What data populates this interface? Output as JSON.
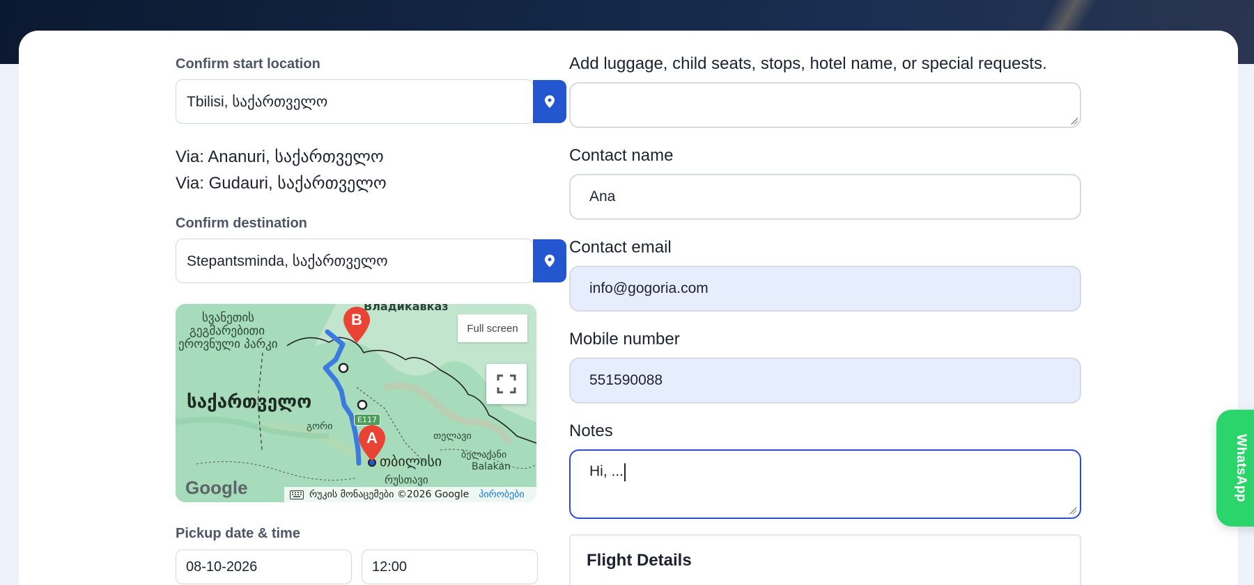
{
  "start": {
    "label": "Confirm start location",
    "value": "Tbilisi, საქართველო"
  },
  "vias": [
    "Via: Ananuri, საქართველო",
    "Via: Gudauri, საქართველო"
  ],
  "destination": {
    "label": "Confirm destination",
    "value": "Stepantsminda, საქართველო"
  },
  "map": {
    "full_screen_label": "Full screen",
    "google": "Google",
    "attribution": "რუკის მონაცემები ©2026 Google",
    "terms": "პირობები",
    "marker_a": "A",
    "marker_b": "B",
    "road_label": "E117",
    "places": {
      "vladikavkaz": "Владикавказ",
      "georgia": "საქართველო",
      "tbilisi": "თბილისი",
      "rustavi": "რუსთავი",
      "gori": "გორი",
      "telavi": "თელავი",
      "belakani": "ბელაქანი",
      "balakan": "Balakan",
      "park1": "სვანეთის",
      "park2": "ეროვნული პარკი",
      "park3": "გეგმარებითი"
    }
  },
  "pickup": {
    "label": "Pickup date & time",
    "date": "08-10-2026",
    "time": "12:00"
  },
  "requests": {
    "label": "Add luggage, child seats, stops, hotel name, or special requests.",
    "value": ""
  },
  "contact_name": {
    "label": "Contact name",
    "value": "Ana"
  },
  "contact_email": {
    "label": "Contact email",
    "value": "info@gogoria.com"
  },
  "mobile": {
    "label": "Mobile number",
    "value": "551590088"
  },
  "notes": {
    "label": "Notes",
    "value": "Hi, ..."
  },
  "flight": {
    "title": "Flight Details"
  },
  "whatsapp": {
    "label": "WhatsApp",
    "color": "#2bd56b"
  },
  "colors": {
    "accent": "#2456d0",
    "focus": "#2c4bd4",
    "filled": "#e6edfd"
  }
}
